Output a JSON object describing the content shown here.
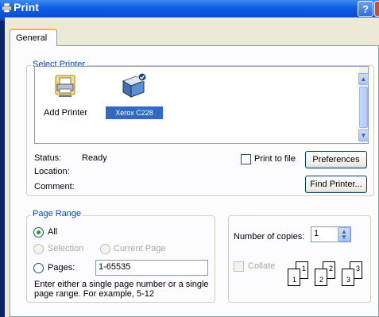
{
  "window": {
    "title": "Print",
    "help_label": "?"
  },
  "tabs": [
    {
      "label": "General"
    }
  ],
  "select_printer": {
    "legend": "Select Printer",
    "items": [
      {
        "label": "Add Printer",
        "icon": "add-printer-icon",
        "selected": false
      },
      {
        "label": "Xerox C228",
        "icon": "network-printer-icon",
        "selected": true
      }
    ]
  },
  "status": {
    "status_label": "Status:",
    "status_value": "Ready",
    "location_label": "Location:",
    "location_value": "",
    "comment_label": "Comment:",
    "comment_value": ""
  },
  "print_to_file": {
    "label": "Print to file",
    "checked": false
  },
  "buttons": {
    "preferences": "Preferences",
    "find_printer": "Find Printer..."
  },
  "page_range": {
    "legend": "Page Range",
    "all_label": "All",
    "selection_label": "Selection",
    "current_page_label": "Current Page",
    "pages_label": "Pages:",
    "pages_value": "1-65535",
    "hint": "Enter either a single page number or a single page range.  For example, 5-12"
  },
  "copies": {
    "label": "Number of copies:",
    "value": "1",
    "collate_label": "Collate",
    "collate_checked": false,
    "collate_pages": [
      "1",
      "1",
      "2",
      "2",
      "3",
      "3"
    ]
  },
  "colors": {
    "accent": "#0046d5",
    "selection": "#316ac5",
    "titlebar": "#0a52d8"
  }
}
